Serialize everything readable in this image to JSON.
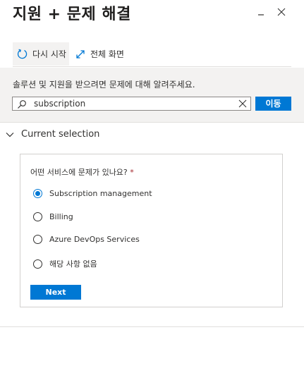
{
  "header": {
    "title": "지원 + 문제 해결"
  },
  "toolbar": {
    "restart_label": "다시 시작",
    "fullscreen_label": "전체 화면"
  },
  "search": {
    "prompt": "솔루션 및 지원을 받으려면 문제에 대해 알려주세요.",
    "value": "subscription",
    "go_label": "이동"
  },
  "section": {
    "label": "Current selection"
  },
  "question": {
    "label": "어떤 서비스에 문제가 있나요?",
    "required_mark": "*",
    "selected_index": 0,
    "options": [
      "Subscription management",
      "Billing",
      "Azure DevOps Services",
      "해당 사항 없음"
    ]
  },
  "actions": {
    "next_label": "Next"
  },
  "colors": {
    "accent": "#0078d4",
    "band": "#f3f2f1",
    "required": "#a4262c"
  },
  "icons": [
    "minimize-icon",
    "close-icon",
    "restart-icon",
    "expand-icon",
    "search-icon",
    "clear-icon",
    "chevron-down-icon"
  ]
}
